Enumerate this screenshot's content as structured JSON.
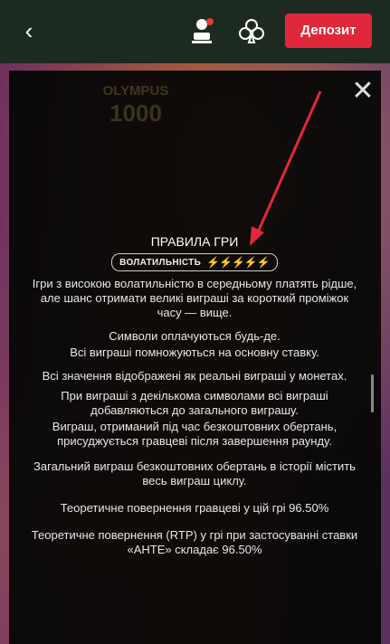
{
  "topbar": {
    "back_icon": "chevron-left-icon",
    "deposit_label": "Депозит"
  },
  "game_bg": {
    "faint_title": "OLYMPUS",
    "faint_number": "1000"
  },
  "rules": {
    "title": "ПРАВИЛА ГРИ",
    "volatility_label": "ВОЛАТИЛЬНІСТЬ",
    "volatility_bolts": "⚡⚡⚡⚡⚡",
    "paragraphs": [
      "Ігри з високою волатильністю в середньому платять рідше, але шанс отримати великі виграші за короткий проміжок часу — вище.",
      "Символи оплачуються будь-де.",
      "Всі виграші помножуються на основну ставку.",
      "Всі значення відображені як реальні виграші у монетах.",
      "При виграші з декількома символами всі виграші добавляються до загального виграшу.",
      "Виграш, отриманий під час безкоштовних обертань, присуджується гравцеві після завершення раунду.",
      "Загальний виграш безкоштовних обертань в історії містить весь виграш циклу.",
      "Теоретичне повернення гравцеві у цій грі 96.50%",
      "Теоретичне повернення (RTP) у грі при застосуванні ставки «АНТЕ» складає 96.50%"
    ]
  },
  "colors": {
    "topbar": "#1d2a21",
    "deposit": "#e0283a",
    "bolt": "#f5c000",
    "arrow": "#e0283a"
  }
}
